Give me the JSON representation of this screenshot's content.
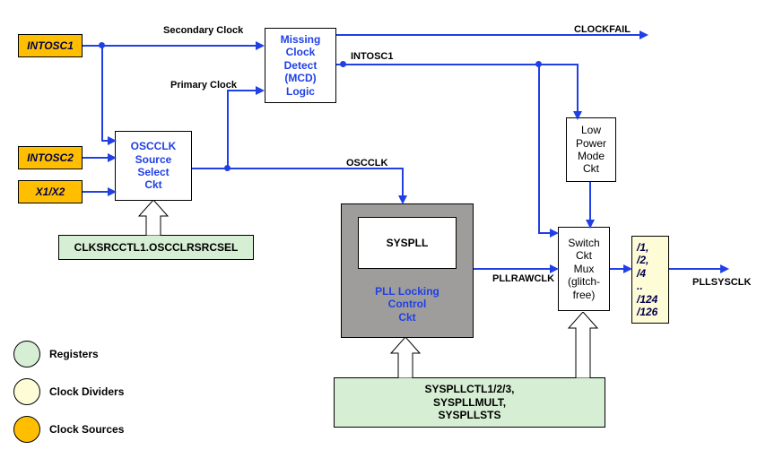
{
  "sources": {
    "intosc1": "INTOSC1",
    "intosc2": "INTOSC2",
    "x1x2": "X1/X2"
  },
  "blocks": {
    "oscclk_select": "OSCCLK\nSource\nSelect\nCkt",
    "mcd": "Missing\nClock\nDetect\n(MCD)\nLogic",
    "lpm": "Low\nPower\nMode\nCkt",
    "syspll": "SYSPLL",
    "pll_ctrl": "PLL Locking\nControl\nCkt",
    "switch_mux": "Switch\nCkt\nMux\n(glitch-\nfree)",
    "divider": "/1,\n/2,\n/4\n..\n/124\n/126"
  },
  "registers": {
    "clksrcctl": "CLKSRCCTL1.OSCCLRSRCSEL",
    "syspll_regs": "SYSPLLCTL1/2/3,\nSYSPLLMULT,\nSYSPLLSTS"
  },
  "signals": {
    "secondary_clock": "Secondary Clock",
    "primary_clock": "Primary Clock",
    "intosc1": "INTOSC1",
    "oscclk": "OSCCLK",
    "clockfail": "CLOCKFAIL",
    "pllrawclk": "PLLRAWCLK",
    "pllsysclk": "PLLSYSCLK"
  },
  "legend": {
    "registers": "Registers",
    "clock_dividers": "Clock Dividers",
    "clock_sources": "Clock Sources"
  }
}
